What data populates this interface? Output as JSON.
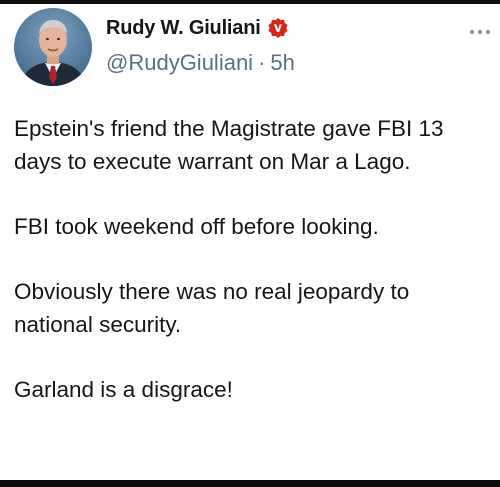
{
  "author": {
    "display_name": "Rudy W. Giuliani",
    "handle": "@RudyGiuliani",
    "separator": "·",
    "timestamp": "5h",
    "badge_icon": "verified-badge-icon",
    "badge_color": "#d9251c",
    "avatar_icon": "profile-photo"
  },
  "menu": {
    "icon": "more-options-icon",
    "color": "#8899a6"
  },
  "tweet": {
    "paragraphs": [
      "Epstein's friend the Magistrate gave FBI 13 days to execute warrant on Mar a Lago.",
      "FBI took weekend off before looking.",
      "Obviously there was no real jeopardy to national security.",
      "Garland is a disgrace!"
    ]
  },
  "colors": {
    "text": "#14171a",
    "secondary_text": "#5b7083",
    "background": "#ffffff",
    "frame": "#000000"
  }
}
